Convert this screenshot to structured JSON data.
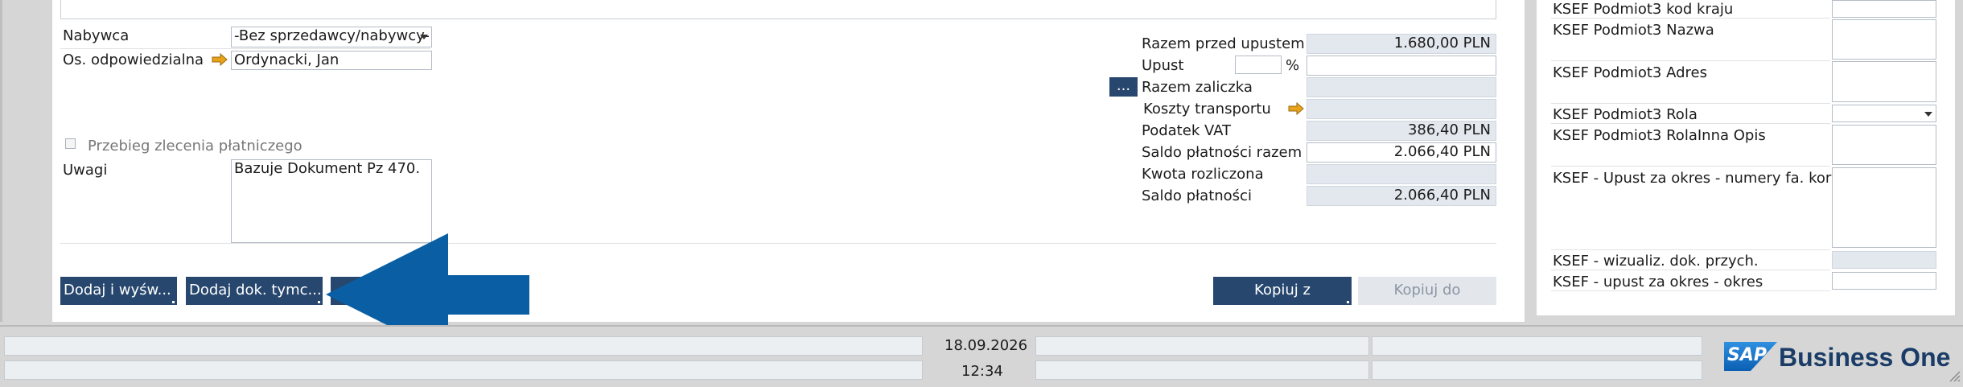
{
  "form": {
    "buyer_label": "Nabywca",
    "buyer_value": "-Bez sprzedawcy/nabywcy-",
    "owner_label": "Os. odpowiedzialna",
    "owner_value": "Ordynacki, Jan",
    "checkbox_label": "Przebieg zlecenia płatniczego",
    "remarks_label": "Uwagi",
    "remarks_value": "Bazuje Dokument Pz 470."
  },
  "totals": {
    "before_discount_label": "Razem przed upustem",
    "before_discount_value": "1.680,00 PLN",
    "discount_label": "Upust",
    "discount_pct_symbol": "%",
    "dots_label": "...",
    "down_payment_label": "Razem zaliczka",
    "freight_label": "Koszty transportu",
    "vat_label": "Podatek VAT",
    "vat_value": "386,40 PLN",
    "total_payment_label": "Saldo płatności razem",
    "total_payment_value": "2.066,40 PLN",
    "settled_label": "Kwota rozliczona",
    "balance_label": "Saldo płatności",
    "balance_value": "2.066,40 PLN"
  },
  "buttons": {
    "add_and_view": "Dodaj i wyśw...",
    "add_draft": "Dodaj dok. tymc...",
    "copy_from": "Kopiuj z",
    "copy_to": "Kopiuj do"
  },
  "ksef": {
    "items": [
      {
        "label": "KSEF Podmiot3 kod kraju"
      },
      {
        "label": "KSEF Podmiot3 Nazwa"
      },
      {
        "label": "KSEF Podmiot3 Adres"
      },
      {
        "label": "KSEF Podmiot3 Rola"
      },
      {
        "label": "KSEF Podmiot3 RolaInna Opis"
      },
      {
        "label": "KSEF - Upust za okres - numery fa. koryg."
      },
      {
        "label": "KSEF - wizualiz. dok. przych."
      },
      {
        "label": "KSEF - upust za okres - okres"
      }
    ]
  },
  "statusbar": {
    "date": "18.09.2026",
    "time": "12:34"
  },
  "brand": {
    "logo_text": "SAP",
    "product": "Business One",
    "logo_color": "#1a73c8"
  },
  "colors": {
    "button": "#27476e",
    "arrow": "#0a5fa4",
    "link_arrow": "#e8a31a"
  }
}
